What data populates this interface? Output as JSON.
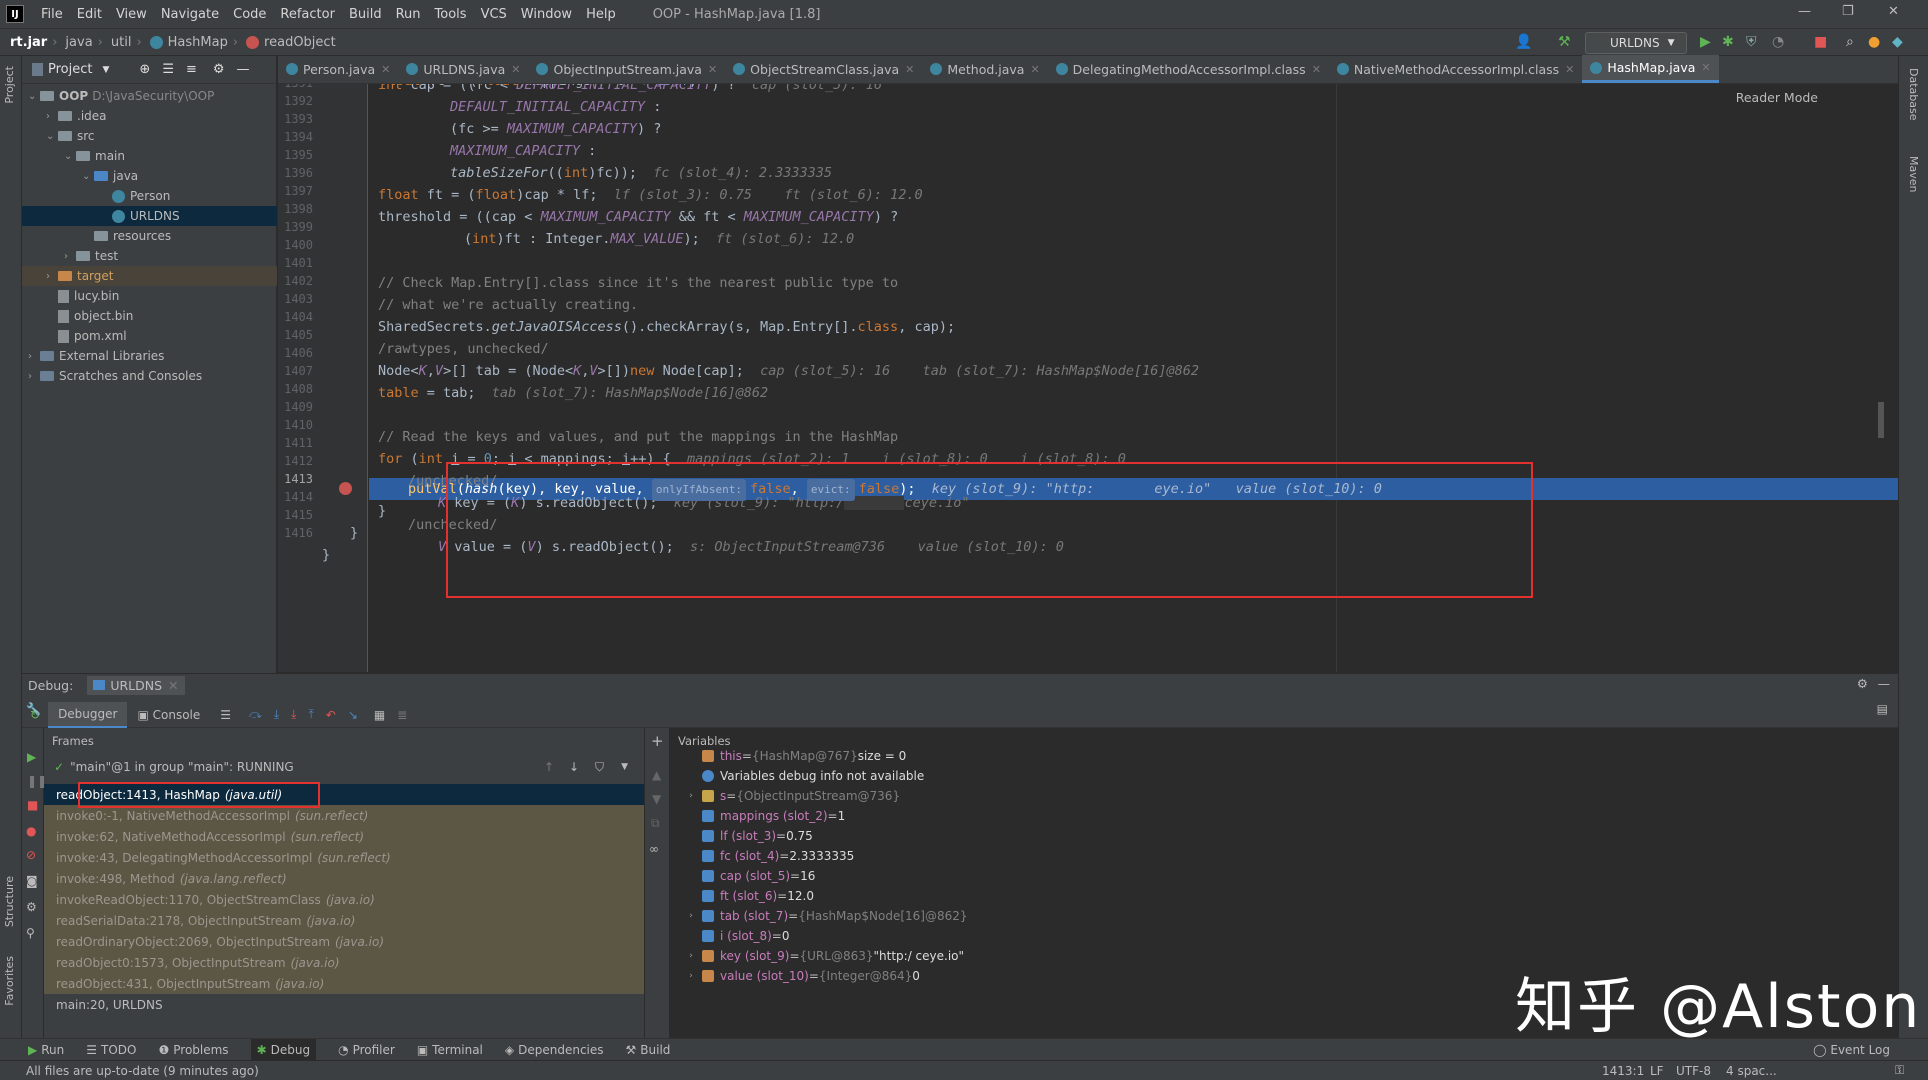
{
  "menubar": {
    "items": [
      "File",
      "Edit",
      "View",
      "Navigate",
      "Code",
      "Refactor",
      "Build",
      "Run",
      "Tools",
      "VCS",
      "Window",
      "Help"
    ],
    "window_title": "OOP - HashMap.java [1.8]"
  },
  "breadcrumb": [
    "rt.jar",
    "java",
    "util",
    "HashMap",
    "readObject"
  ],
  "toolbar": {
    "run_config": "URLDNS"
  },
  "project": {
    "header": "Project",
    "tree": [
      {
        "label": "OOP",
        "extra": "D:\\JavaSecurity\\OOP",
        "depth": 0,
        "kind": "folder"
      },
      {
        "label": ".idea",
        "depth": 1,
        "kind": "folder"
      },
      {
        "label": "src",
        "depth": 1,
        "kind": "folder"
      },
      {
        "label": "main",
        "depth": 2,
        "kind": "folder"
      },
      {
        "label": "java",
        "depth": 3,
        "kind": "folderblue"
      },
      {
        "label": "Person",
        "depth": 4,
        "kind": "class"
      },
      {
        "label": "URLDNS",
        "depth": 4,
        "kind": "class",
        "selected": true
      },
      {
        "label": "resources",
        "depth": 3,
        "kind": "folder"
      },
      {
        "label": "test",
        "depth": 2,
        "kind": "folder"
      },
      {
        "label": "target",
        "depth": 1,
        "kind": "folderorange"
      },
      {
        "label": "lucy.bin",
        "depth": 1,
        "kind": "file"
      },
      {
        "label": "object.bin",
        "depth": 1,
        "kind": "file"
      },
      {
        "label": "pom.xml",
        "depth": 1,
        "kind": "file"
      },
      {
        "label": "External Libraries",
        "depth": 0,
        "kind": "lib"
      },
      {
        "label": "Scratches and Consoles",
        "depth": 0,
        "kind": "lib"
      }
    ]
  },
  "editor_tabs": [
    {
      "label": "Person.java"
    },
    {
      "label": "URLDNS.java"
    },
    {
      "label": "ObjectInputStream.java"
    },
    {
      "label": "ObjectStreamClass.java"
    },
    {
      "label": "Method.java"
    },
    {
      "label": "DelegatingMethodAccessorImpl.class"
    },
    {
      "label": "NativeMethodAccessorImpl.class"
    },
    {
      "label": "HashMap.java",
      "active": true
    }
  ],
  "editor": {
    "reader_mode": "Reader Mode",
    "line_numbers": [
      "1391",
      "1392",
      "1393",
      "1394",
      "1395",
      "1396",
      "1397",
      "1398",
      "1399",
      "1400",
      "1401",
      "1402",
      "1403",
      "1404",
      "1405",
      "1406",
      "1407",
      "1408",
      "1409",
      "1410",
      "1411",
      "1412",
      "1413",
      "1414",
      "1415",
      "1416"
    ],
    "hints": {
      "l1391": "cap (slot_5): 16",
      "l1395": "fc (slot_4): 2.3333335",
      "l1396": "lf (slot_3): 0.75    ft (slot_6): 12.0",
      "l1398": "ft (slot_6): 12.0",
      "l1404": "cap (slot_5): 16    tab (slot_7): HashMap$Node[16]@862",
      "l1405": "tab (slot_7): HashMap$Node[16]@862",
      "l1408": "mappings (slot_2): 1    i (slot_8): 0    i (slot_8): 0",
      "l1410": "key (slot_9): \"http:/",
      "l1410b": "ceye.io\"",
      "l1412": "s: ObjectInputStream@736    value (slot_10): 0",
      "l1413a": "key (slot_9): \"http:",
      "l1413b": "eye.io\"",
      "l1413c": "value (slot_10): 0"
    },
    "inline_params": {
      "onlyIfAbsent": "onlyIfAbsent:",
      "evict": "evict:",
      "false": "false"
    }
  },
  "debug": {
    "title": "Debug:",
    "session": "URLDNS",
    "tabs": [
      "Debugger",
      "Console"
    ],
    "frames_label": "Frames",
    "variables_label": "Variables",
    "thread": "\"main\"@1 in group \"main\": RUNNING",
    "frames": [
      {
        "text": "readObject:1413, HashMap",
        "pkg": "(java.util)",
        "selected": true
      },
      {
        "text": "invoke0:-1, NativeMethodAccessorImpl",
        "pkg": "(sun.reflect)"
      },
      {
        "text": "invoke:62, NativeMethodAccessorImpl",
        "pkg": "(sun.reflect)"
      },
      {
        "text": "invoke:43, DelegatingMethodAccessorImpl",
        "pkg": "(sun.reflect)"
      },
      {
        "text": "invoke:498, Method",
        "pkg": "(java.lang.reflect)"
      },
      {
        "text": "invokeReadObject:1170, ObjectStreamClass",
        "pkg": "(java.io)"
      },
      {
        "text": "readSerialData:2178, ObjectInputStream",
        "pkg": "(java.io)"
      },
      {
        "text": "readOrdinaryObject:2069, ObjectInputStream",
        "pkg": "(java.io)"
      },
      {
        "text": "readObject0:1573, ObjectInputStream",
        "pkg": "(java.io)"
      },
      {
        "text": "readObject:431, ObjectInputStream",
        "pkg": "(java.io)"
      },
      {
        "text": "main:20, URLDNS",
        "pkg": "",
        "plain": true
      }
    ],
    "variables": [
      {
        "name": "this",
        "eq": " = ",
        "dim": "{HashMap@767}",
        "val": "  size = 0",
        "expand": false,
        "icon": "#c7874b"
      },
      {
        "name": "",
        "eq": "",
        "dim": "",
        "val": "Variables debug info not available",
        "expand": false,
        "icon": "#4a88c7",
        "info": true
      },
      {
        "name": "s",
        "eq": " = ",
        "dim": "{ObjectInputStream@736}",
        "val": "",
        "expand": true,
        "icon": "#c7a64b"
      },
      {
        "name": "mappings (slot_2)",
        "eq": " = ",
        "dim": "",
        "val": "1",
        "expand": false,
        "icon": "#4a88c7"
      },
      {
        "name": "lf (slot_3)",
        "eq": " = ",
        "dim": "",
        "val": "0.75",
        "expand": false,
        "icon": "#4a88c7"
      },
      {
        "name": "fc (slot_4)",
        "eq": " = ",
        "dim": "",
        "val": "2.3333335",
        "expand": false,
        "icon": "#4a88c7"
      },
      {
        "name": "cap (slot_5)",
        "eq": " = ",
        "dim": "",
        "val": "16",
        "expand": false,
        "icon": "#4a88c7"
      },
      {
        "name": "ft (slot_6)",
        "eq": " = ",
        "dim": "",
        "val": "12.0",
        "expand": false,
        "icon": "#4a88c7"
      },
      {
        "name": "tab (slot_7)",
        "eq": " = ",
        "dim": "{HashMap$Node[16]@862}",
        "val": "",
        "expand": true,
        "icon": "#4a88c7"
      },
      {
        "name": "i (slot_8)",
        "eq": " = ",
        "dim": "",
        "val": "0",
        "expand": false,
        "icon": "#4a88c7"
      },
      {
        "name": "key (slot_9)",
        "eq": " = ",
        "dim": "{URL@863}",
        "val": " \"http:/          ceye.io\"",
        "expand": true,
        "icon": "#c7874b"
      },
      {
        "name": "value (slot_10)",
        "eq": " = ",
        "dim": "{Integer@864}",
        "val": " 0",
        "expand": true,
        "icon": "#c7874b"
      }
    ]
  },
  "bottom_tools": [
    "Run",
    "TODO",
    "Problems",
    "Debug",
    "Profiler",
    "Terminal",
    "Dependencies",
    "Build"
  ],
  "event_log": "Event Log",
  "status": {
    "message": "All files are up-to-date (9 minutes ago)",
    "position": "1413:1",
    "line_sep": "LF",
    "encoding": "UTF-8",
    "indent": "4 spac..."
  },
  "watermark": "知乎 @Alston",
  "side_tabs": {
    "left": [
      "Project",
      "Structure",
      "Favorites"
    ],
    "right": [
      "Database",
      "Maven"
    ]
  }
}
